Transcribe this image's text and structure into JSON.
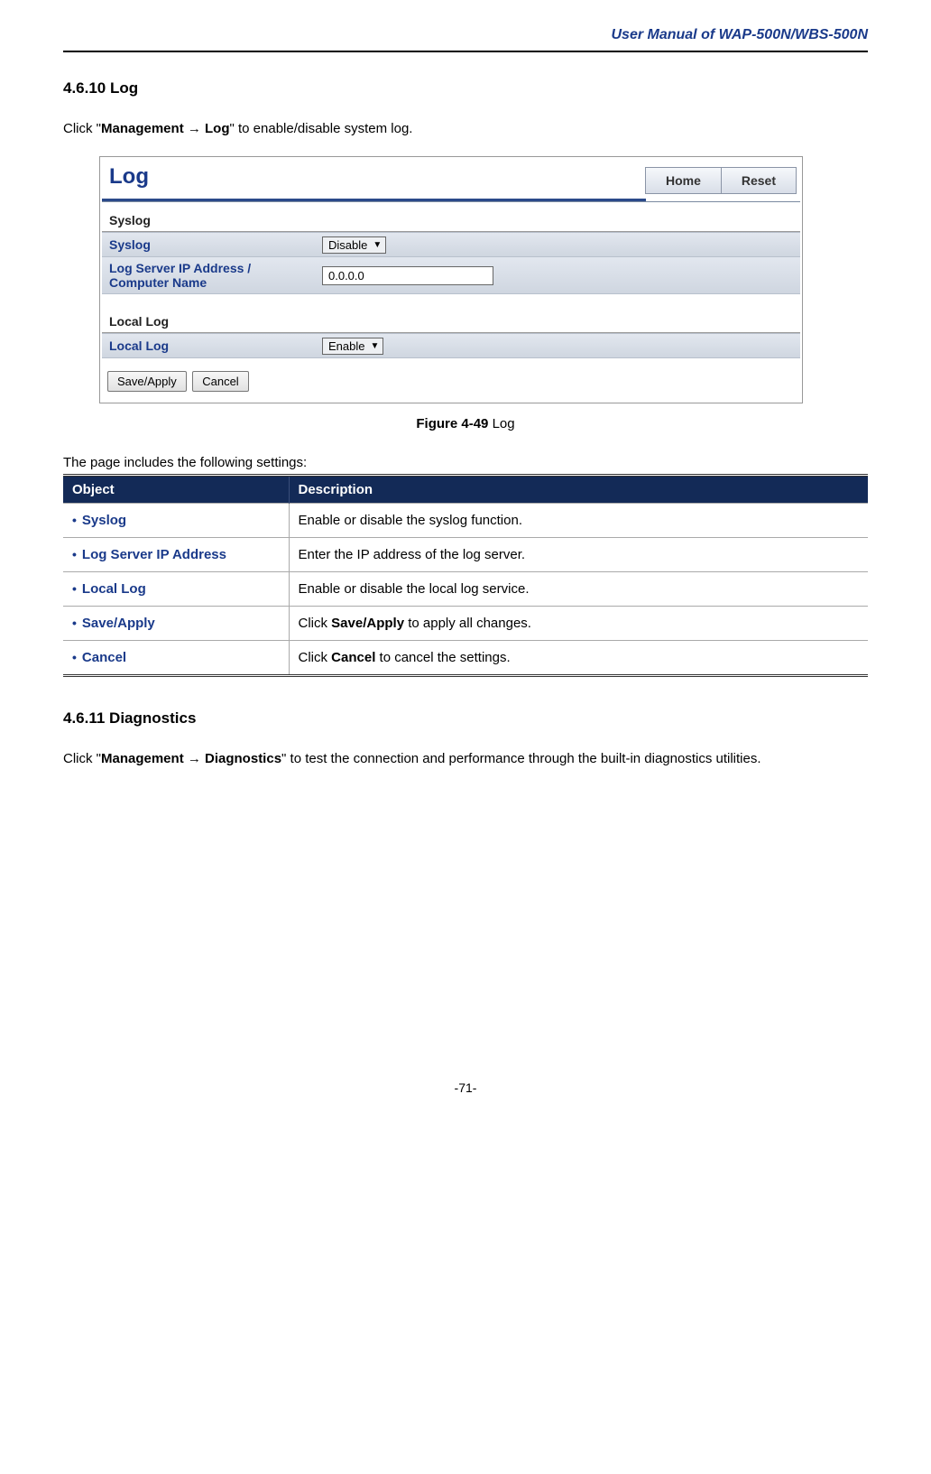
{
  "doc_header": "User Manual of WAP-500N/WBS-500N",
  "section1": {
    "heading": "4.6.10 Log",
    "intro_prefix": "Click \"",
    "intro_bold": "Management → Log",
    "intro_suffix": "\" to enable/disable system log."
  },
  "figure": {
    "title": "Log",
    "home_btn": "Home",
    "reset_btn": "Reset",
    "syslog_group": "Syslog",
    "syslog_label": "Syslog",
    "syslog_value": "Disable",
    "ip_label": "Log Server IP Address / Computer Name",
    "ip_value": "0.0.0.0",
    "locallog_group": "Local Log",
    "locallog_label": "Local Log",
    "locallog_value": "Enable",
    "save_btn": "Save/Apply",
    "cancel_btn": "Cancel"
  },
  "figure_caption_bold": "Figure 4-49",
  "figure_caption_rest": " Log",
  "settings_intro": "The page includes the following settings:",
  "settings_headers": {
    "object": "Object",
    "description": "Description"
  },
  "settings_rows": [
    {
      "obj": "Syslog",
      "desc_pre": "Enable or disable the syslog function.",
      "desc_bold": "",
      "desc_post": ""
    },
    {
      "obj": "Log Server IP Address",
      "desc_pre": "Enter the IP address of the log server.",
      "desc_bold": "",
      "desc_post": ""
    },
    {
      "obj": "Local Log",
      "desc_pre": "Enable or disable the local log service.",
      "desc_bold": "",
      "desc_post": ""
    },
    {
      "obj": "Save/Apply",
      "desc_pre": "Click ",
      "desc_bold": "Save/Apply",
      "desc_post": " to apply all changes."
    },
    {
      "obj": "Cancel",
      "desc_pre": "Click ",
      "desc_bold": "Cancel",
      "desc_post": " to cancel the settings."
    }
  ],
  "section2": {
    "heading": "4.6.11 Diagnostics",
    "intro_prefix": "Click \"",
    "intro_bold": "Management → Diagnostics",
    "intro_suffix": "\" to test the connection and performance through the built-in diagnostics utilities."
  },
  "page_number": "-71-"
}
